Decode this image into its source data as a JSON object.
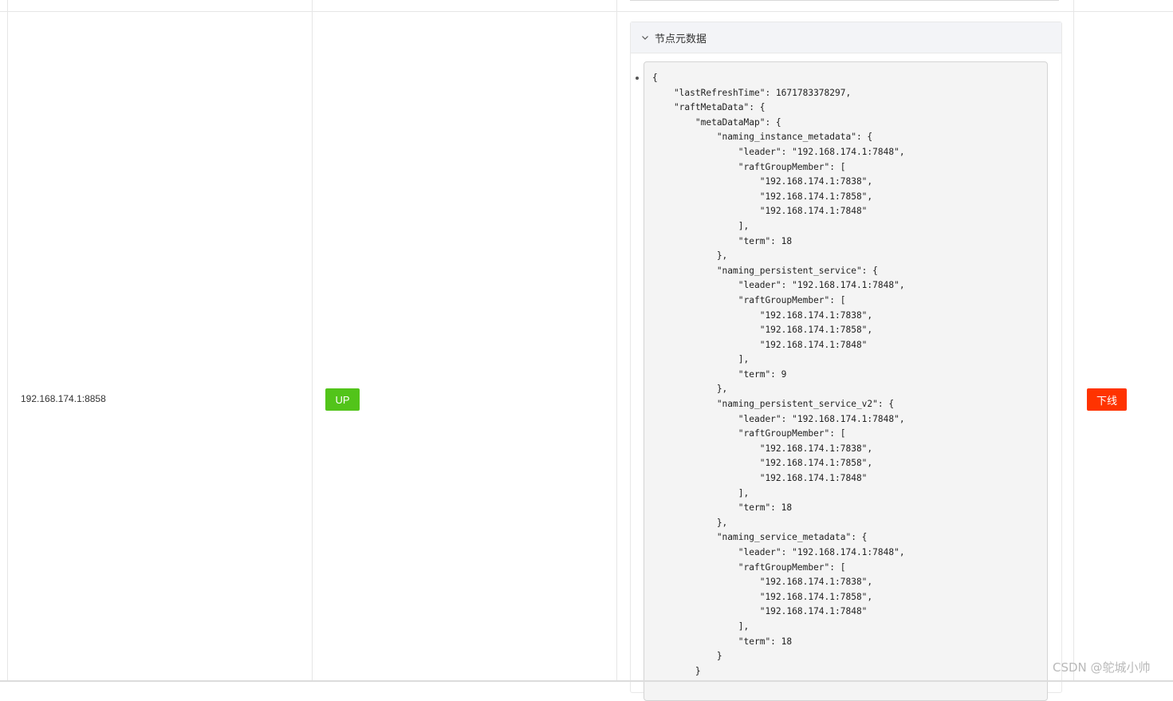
{
  "row": {
    "address": "192.168.174.1:8858",
    "state_label": "UP",
    "offline_label": "下线"
  },
  "metadata_panel": {
    "title": "节点元数据",
    "json_text": "{\n    \"lastRefreshTime\": 1671783378297,\n    \"raftMetaData\": {\n        \"metaDataMap\": {\n            \"naming_instance_metadata\": {\n                \"leader\": \"192.168.174.1:7848\",\n                \"raftGroupMember\": [\n                    \"192.168.174.1:7838\",\n                    \"192.168.174.1:7858\",\n                    \"192.168.174.1:7848\"\n                ],\n                \"term\": 18\n            },\n            \"naming_persistent_service\": {\n                \"leader\": \"192.168.174.1:7848\",\n                \"raftGroupMember\": [\n                    \"192.168.174.1:7838\",\n                    \"192.168.174.1:7858\",\n                    \"192.168.174.1:7848\"\n                ],\n                \"term\": 9\n            },\n            \"naming_persistent_service_v2\": {\n                \"leader\": \"192.168.174.1:7848\",\n                \"raftGroupMember\": [\n                    \"192.168.174.1:7838\",\n                    \"192.168.174.1:7858\",\n                    \"192.168.174.1:7848\"\n                ],\n                \"term\": 18\n            },\n            \"naming_service_metadata\": {\n                \"leader\": \"192.168.174.1:7848\",\n                \"raftGroupMember\": [\n                    \"192.168.174.1:7838\",\n                    \"192.168.174.1:7858\",\n                    \"192.168.174.1:7848\"\n                ],\n                \"term\": 18\n            }\n        }"
  },
  "watermark": "CSDN @鸵城小帅",
  "colors": {
    "up_green": "#52c41a",
    "offline_red": "#ff3300",
    "panel_header": "#f3f4f7",
    "code_bg": "#f4f4f4"
  },
  "icons": {
    "collapse_toggle": "chevron-down-icon"
  }
}
